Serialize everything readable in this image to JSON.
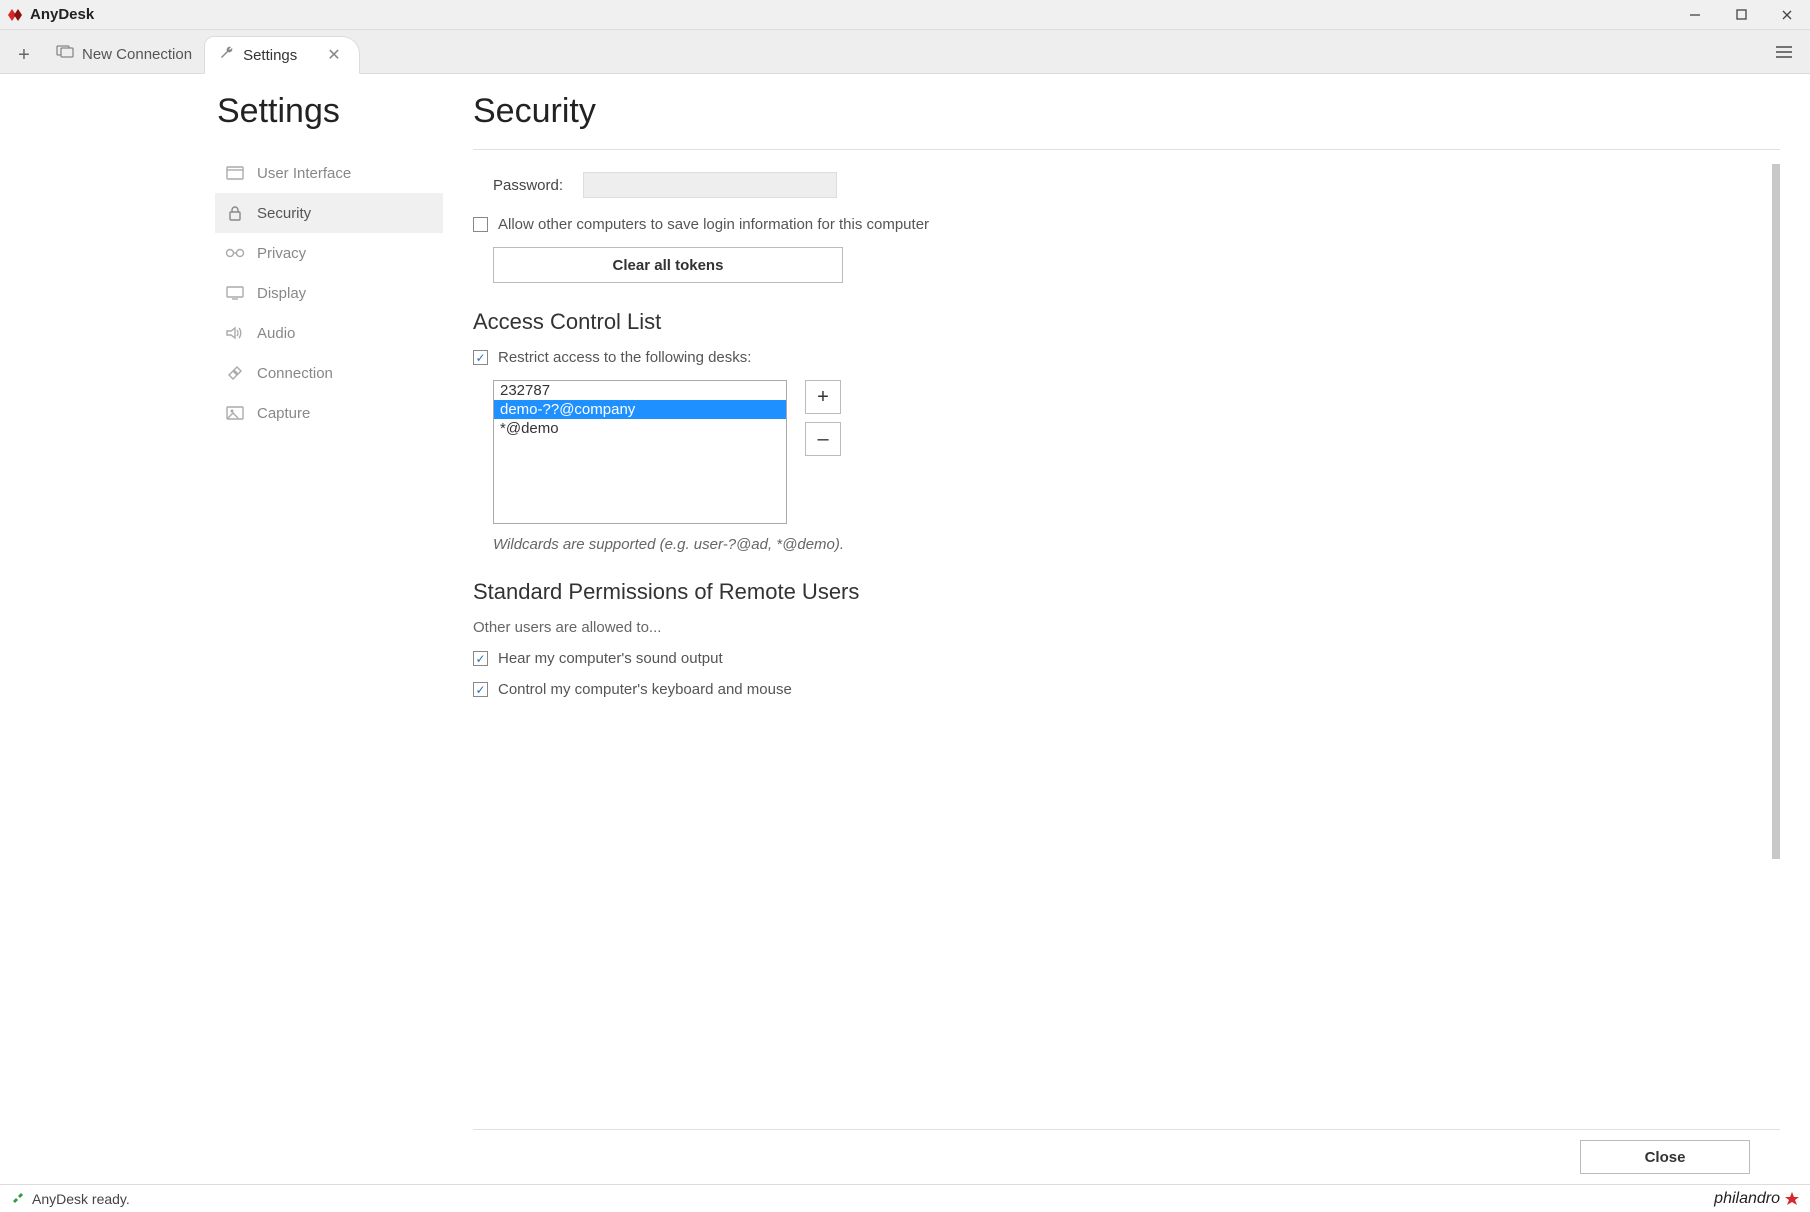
{
  "app": {
    "title": "AnyDesk"
  },
  "tabs": {
    "new_connection": "New Connection",
    "settings": "Settings"
  },
  "sidebar": {
    "title": "Settings",
    "items": [
      {
        "label": "User Interface"
      },
      {
        "label": "Security"
      },
      {
        "label": "Privacy"
      },
      {
        "label": "Display"
      },
      {
        "label": "Audio"
      },
      {
        "label": "Connection"
      },
      {
        "label": "Capture"
      }
    ]
  },
  "page": {
    "title": "Security",
    "password_label": "Password:",
    "allow_save_login": "Allow other computers to save login information for this computer",
    "clear_tokens": "Clear all tokens",
    "acl": {
      "heading": "Access Control List",
      "restrict_label": "Restrict access to the following desks:",
      "items": [
        "232787",
        "demo-??@company",
        "*@demo"
      ],
      "selected_index": 1,
      "add": "+",
      "remove": "–",
      "hint": "Wildcards are supported (e.g. user-?@ad, *@demo)."
    },
    "perms": {
      "heading": "Standard Permissions of Remote Users",
      "intro": "Other users are allowed to...",
      "hear_sound": "Hear my computer's sound output",
      "control_kbm": "Control my computer's keyboard and mouse"
    },
    "close": "Close"
  },
  "status": {
    "text": "AnyDesk ready.",
    "brand": "philandro"
  }
}
